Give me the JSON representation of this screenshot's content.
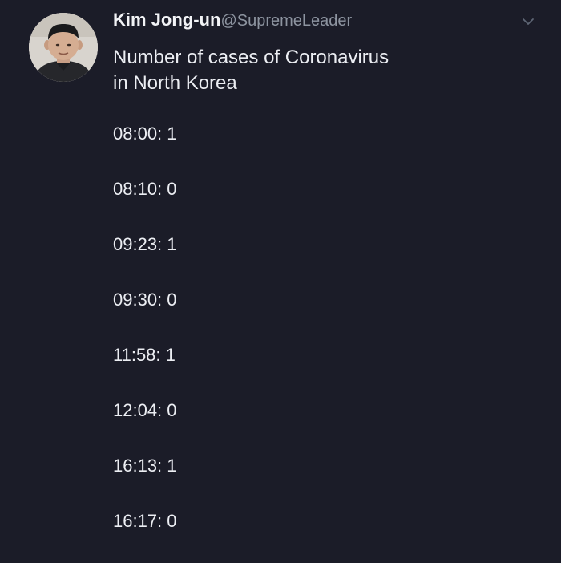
{
  "author": {
    "display_name": "Kim Jong-un",
    "handle": "@SupremeLeader",
    "avatar_icon": "profile-photo"
  },
  "tweet": {
    "text_line1": "Number of cases of Coronavirus",
    "text_line2": "in North Korea",
    "lines": [
      "08:00: 1",
      "08:10: 0",
      "09:23: 1",
      "09:30: 0",
      "11:58: 1",
      "12:04: 0",
      "16:13: 1",
      "16:17: 0"
    ]
  },
  "colors": {
    "background": "#1b1c28",
    "text": "#eceef3",
    "handle": "#8d94a0"
  }
}
